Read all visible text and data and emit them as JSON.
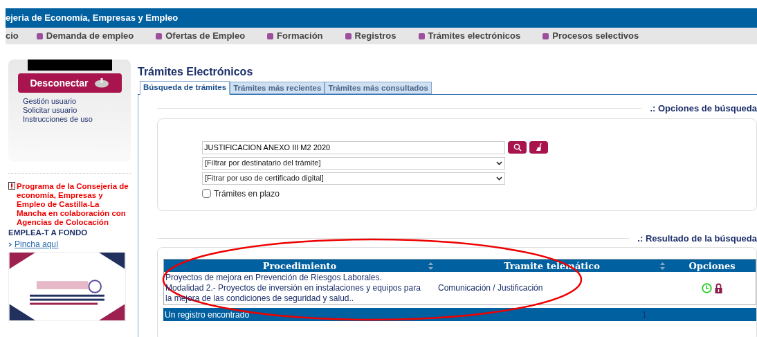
{
  "header": {
    "title": "ejeria de Economía, Empresas y Empleo"
  },
  "nav": [
    {
      "label": "cio",
      "bullet": false
    },
    {
      "label": "Demanda de empleo",
      "bullet": true
    },
    {
      "label": "Ofertas de Empleo",
      "bullet": true
    },
    {
      "label": "Formación",
      "bullet": true
    },
    {
      "label": "Registros",
      "bullet": true
    },
    {
      "label": "Trámites electrónicos",
      "bullet": true
    },
    {
      "label": "Procesos selectivos",
      "bullet": true
    }
  ],
  "sidebar": {
    "logout_button": "Desconectar",
    "links": [
      "Gestión usuario",
      "Solicitar usuario",
      "Instrucciones de uso"
    ],
    "promo": {
      "text": "Programa de la Consejeria de economía, Empresas y Empleo de Castilla-La Mancha en colaboración con Agencias de Colocación",
      "title": "EMPLEA-T A FONDO",
      "link": "Pincha aquí"
    }
  },
  "page_title": "Trámites Electrónicos",
  "tabs": [
    {
      "label": "Búsqueda de trámites",
      "selected": true
    },
    {
      "label": "Trámites más recientes",
      "selected": false
    },
    {
      "label": "Trámites más consultados",
      "selected": false
    }
  ],
  "search": {
    "heading": ".: Opciones de búsqueda",
    "value": "JUSTIFICACION ANEXO III M2 2020",
    "filters": [
      "[Filtrar por destinatario del trámite]",
      "[Fitrar por uso de certificado digital]"
    ],
    "checkbox": {
      "label": "Trámites en plazo",
      "checked": false
    }
  },
  "results": {
    "heading": ".: Resultado de la búsqueda",
    "columns": [
      {
        "label": "Procedimiento",
        "sortable": true
      },
      {
        "label": "Tramite telemático",
        "sortable": true
      },
      {
        "label": "Opciones",
        "sortable": false
      }
    ],
    "rows": [
      {
        "procedure": "Proyectos de mejora en Prevención de Riesgos Laborales.\nModalidad 2.- Proyectos de inversión en instalaciones y equipos para\nla mejora de las condiciones de seguridad y salud..",
        "tramite": "Comunicación / Justificación"
      }
    ],
    "footer": "Un registro encontrado",
    "page": "1"
  }
}
